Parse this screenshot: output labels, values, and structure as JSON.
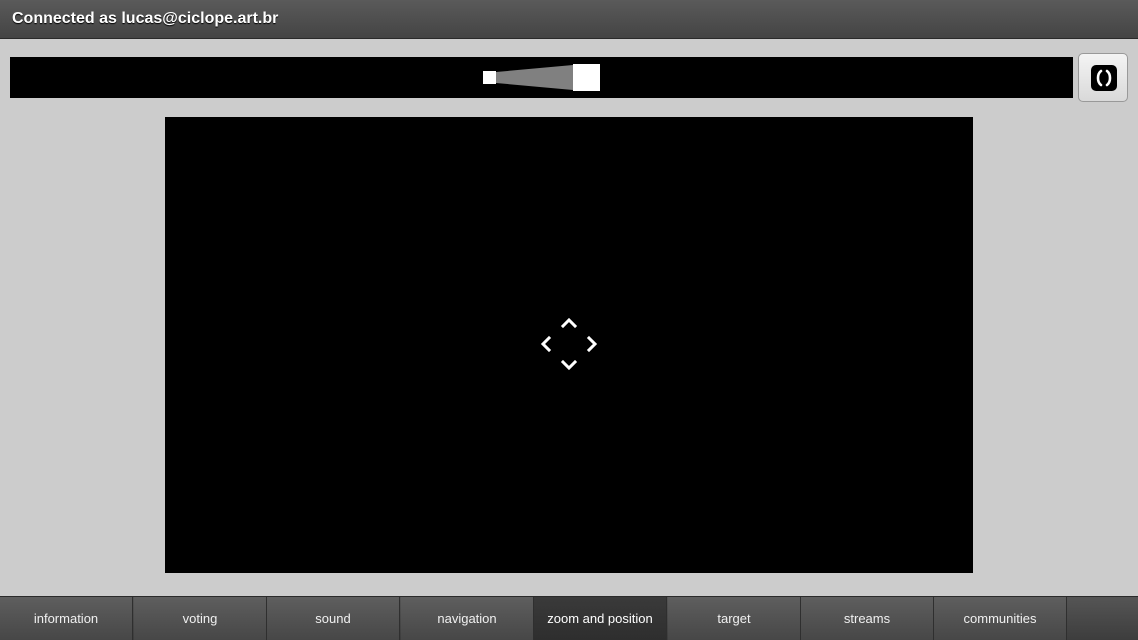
{
  "header": {
    "title": "Connected as lucas@ciclope.art.br"
  },
  "zoom": {
    "level_icon": "zoom-level-cone-icon"
  },
  "refresh_button": {
    "icon": "refresh-icon"
  },
  "viewport": {
    "control_icon": "move-arrows-icon"
  },
  "tabs": [
    {
      "label": "information"
    },
    {
      "label": "voting"
    },
    {
      "label": "sound"
    },
    {
      "label": "navigation"
    },
    {
      "label": "zoom and position"
    },
    {
      "label": "target"
    },
    {
      "label": "streams"
    },
    {
      "label": "communities"
    }
  ],
  "active_tab": "zoom and position",
  "colors": {
    "background": "#cccccc",
    "panel": "#000000",
    "header": "#4a4a4a",
    "tab_active": "#333333"
  }
}
